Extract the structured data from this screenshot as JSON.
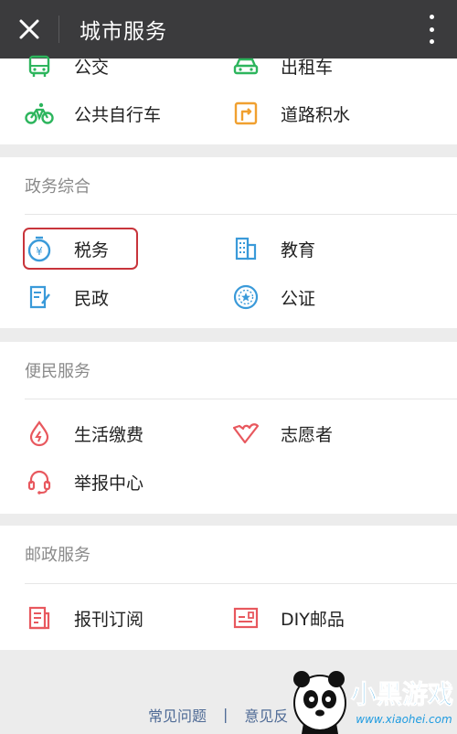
{
  "header": {
    "title": "城市服务"
  },
  "transport": {
    "items": [
      {
        "label": "公交"
      },
      {
        "label": "出租车"
      },
      {
        "label": "公共自行车"
      },
      {
        "label": "道路积水"
      }
    ]
  },
  "government": {
    "title": "政务综合",
    "items": [
      {
        "label": "税务"
      },
      {
        "label": "教育"
      },
      {
        "label": "民政"
      },
      {
        "label": "公证"
      }
    ]
  },
  "convenience": {
    "title": "便民服务",
    "items": [
      {
        "label": "生活缴费"
      },
      {
        "label": "志愿者"
      },
      {
        "label": "举报中心"
      }
    ]
  },
  "postal": {
    "title": "邮政服务",
    "items": [
      {
        "label": "报刊订阅"
      },
      {
        "label": "DIY邮品"
      }
    ]
  },
  "footer": {
    "faq": "常见问题",
    "separator": "|",
    "feedback": "意见反"
  },
  "watermark": {
    "brand": "小黑游戏",
    "url": "www.xiaohei.com"
  },
  "colors": {
    "topbar": "#3b3b3d",
    "green": "#2db55d",
    "orange": "#f0a030",
    "blue": "#3a9ad9",
    "red": "#e8585e",
    "highlight": "#c8343b"
  }
}
